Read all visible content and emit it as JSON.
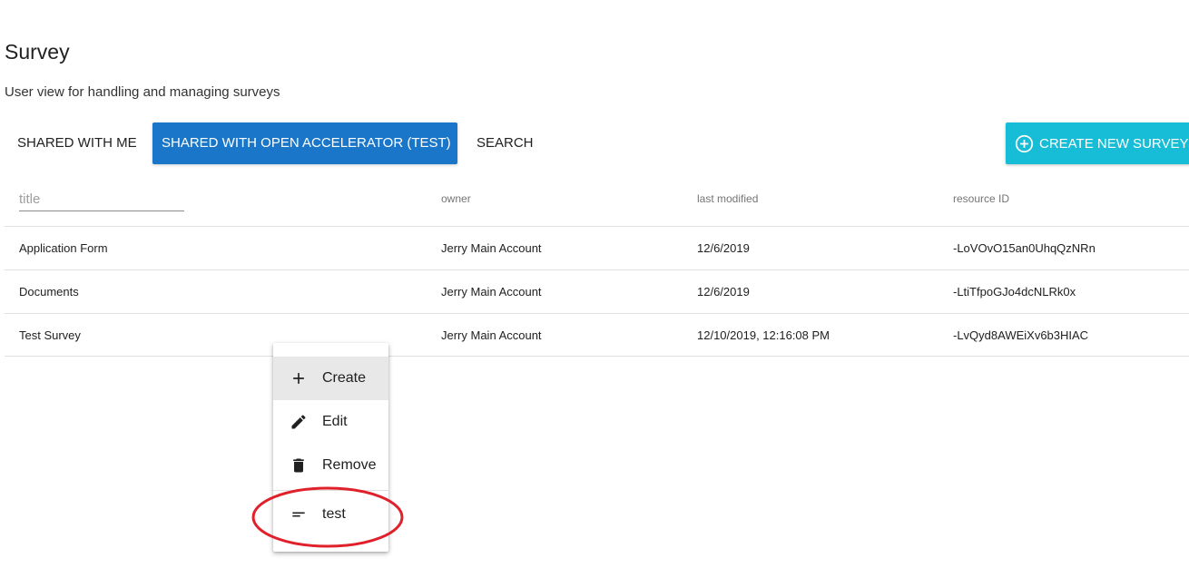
{
  "header": {
    "title": "Survey",
    "subtitle": "User view for handling and managing surveys"
  },
  "tabs": [
    {
      "label": "SHARED WITH ME",
      "active": false
    },
    {
      "label": "SHARED WITH  OPEN ACCELERATOR (TEST)",
      "active": true
    },
    {
      "label": "SEARCH",
      "active": false
    }
  ],
  "create_button": {
    "label": "CREATE NEW SURVEY",
    "icon": "plus-circle-icon",
    "color": "#17bcd6"
  },
  "table": {
    "filter_placeholder": "title",
    "filter_value": "",
    "columns": [
      "title",
      "owner",
      "last modified",
      "resource ID"
    ],
    "rows": [
      [
        "Application Form",
        "Jerry Main Account",
        "12/6/2019",
        "-LoVOvO15an0UhqQzNRn"
      ],
      [
        "Documents",
        "Jerry Main Account",
        "12/6/2019",
        "-LtiTfpoGJo4dcNLRk0x"
      ],
      [
        "Test Survey",
        "Jerry Main Account",
        "12/10/2019, 12:16:08 PM",
        "-LvQyd8AWEiXv6b3HIAC"
      ]
    ]
  },
  "context_menu": {
    "items": [
      {
        "label": "Create",
        "icon": "plus-icon",
        "highlighted": true
      },
      {
        "label": "Edit",
        "icon": "pencil-icon",
        "highlighted": false
      },
      {
        "label": "Remove",
        "icon": "trash-icon",
        "highlighted": false
      },
      {
        "label": "test",
        "icon": "short-text-icon",
        "highlighted": false
      }
    ]
  },
  "colors": {
    "active_tab": "#1976c9",
    "create_button": "#17bcd6",
    "annotation_circle": "#e0202a"
  }
}
